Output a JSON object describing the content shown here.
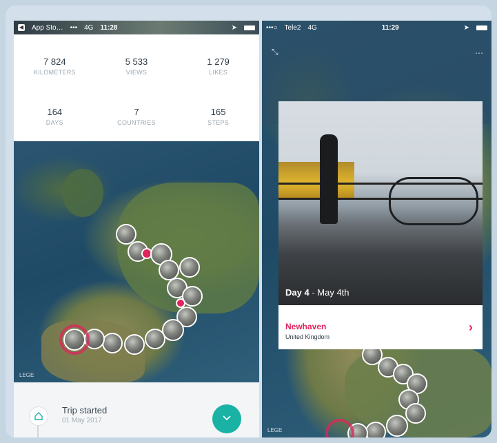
{
  "left_status": {
    "carrier": "App Sto…",
    "signal": "•••",
    "network": "4G",
    "time": "11:28"
  },
  "stats": [
    {
      "value": "7 824",
      "label": "KILOMETERS"
    },
    {
      "value": "5 533",
      "label": "VIEWS"
    },
    {
      "value": "1 279",
      "label": "LIKES"
    },
    {
      "value": "164",
      "label": "DAYS"
    },
    {
      "value": "7",
      "label": "COUNTRIES"
    },
    {
      "value": "165",
      "label": "STEPS"
    }
  ],
  "left_map": {
    "credit": "LEGE"
  },
  "trip": {
    "title": "Trip started",
    "date": "01 May 2017"
  },
  "right_status": {
    "signal": "•••○",
    "carrier": "Tele2",
    "network": "4G",
    "time": "11:29"
  },
  "step_card": {
    "day": "Day 4",
    "date": "May 4th",
    "place": "Newhaven",
    "country": "United Kingdom"
  },
  "right_map": {
    "credit": "LEGE"
  },
  "colors": {
    "accent_red": "#e0245e",
    "fab_teal": "#1ab2a4"
  },
  "icons": {
    "fab": "chevron-down-icon",
    "trip_start": "house-icon",
    "card_arrow": "chevron-right-icon"
  }
}
